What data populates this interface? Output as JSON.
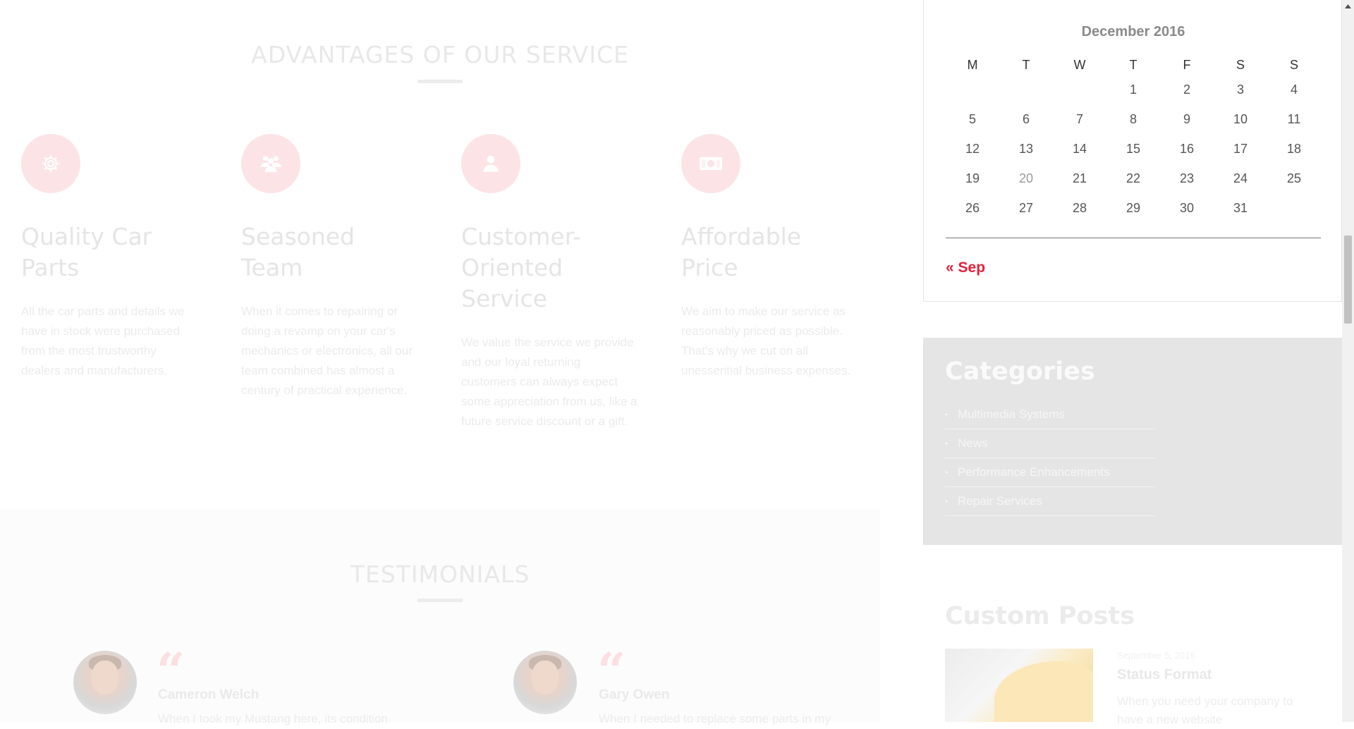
{
  "advantages": {
    "title": "ADVANTAGES OF OUR SERVICE",
    "items": [
      {
        "icon": "gear-icon",
        "title": "Quality Car Parts",
        "text": "All the car parts and details we have in stock were purchased from the most trustworthy dealers and manufacturers."
      },
      {
        "icon": "team-icon",
        "title": "Seasoned Team",
        "text": "When it comes to repairing or doing a revamp on your car's mechanics or electronics, all our team combined has almost a century of practical experience."
      },
      {
        "icon": "user-icon",
        "title": "Customer-Oriented Service",
        "text": "We value the service we provide and our loyal returning customers can always expect some appreciation from us, like a future service discount or a gift."
      },
      {
        "icon": "money-icon",
        "title": "Affordable Price",
        "text": "We aim to make our service as reasonably priced as possible. That's why we cut on all unessential business expenses."
      }
    ]
  },
  "testimonials": {
    "title": "TESTIMONIALS",
    "items": [
      {
        "name": "Cameron Welch",
        "text": "When I took my Mustang here, its condition"
      },
      {
        "name": "Gary Owen",
        "text": "When I needed to replace some parts in my"
      }
    ]
  },
  "calendar": {
    "caption": "December 2016",
    "weekdays": [
      "M",
      "T",
      "W",
      "T",
      "F",
      "S",
      "S"
    ],
    "weeks": [
      [
        "",
        "",
        "",
        "1",
        "2",
        "3",
        "4"
      ],
      [
        "5",
        "6",
        "7",
        "8",
        "9",
        "10",
        "11"
      ],
      [
        "12",
        "13",
        "14",
        "15",
        "16",
        "17",
        "18"
      ],
      [
        "19",
        "20",
        "21",
        "22",
        "23",
        "24",
        "25"
      ],
      [
        "26",
        "27",
        "28",
        "29",
        "30",
        "31",
        ""
      ]
    ],
    "today": "20",
    "prev_link": "« Sep"
  },
  "categories": {
    "title": "Categories",
    "items": [
      "Multimedia Systems",
      "News",
      "Performance Enhancements",
      "Repair Services"
    ]
  },
  "custom_posts": {
    "title": "Custom Posts",
    "items": [
      {
        "date": "September 5, 2016",
        "title": "Status Format",
        "excerpt": "When you need your company to have a new website"
      }
    ]
  },
  "colors": {
    "accent": "#e6213b",
    "icon_circle": "#fce4e6"
  }
}
